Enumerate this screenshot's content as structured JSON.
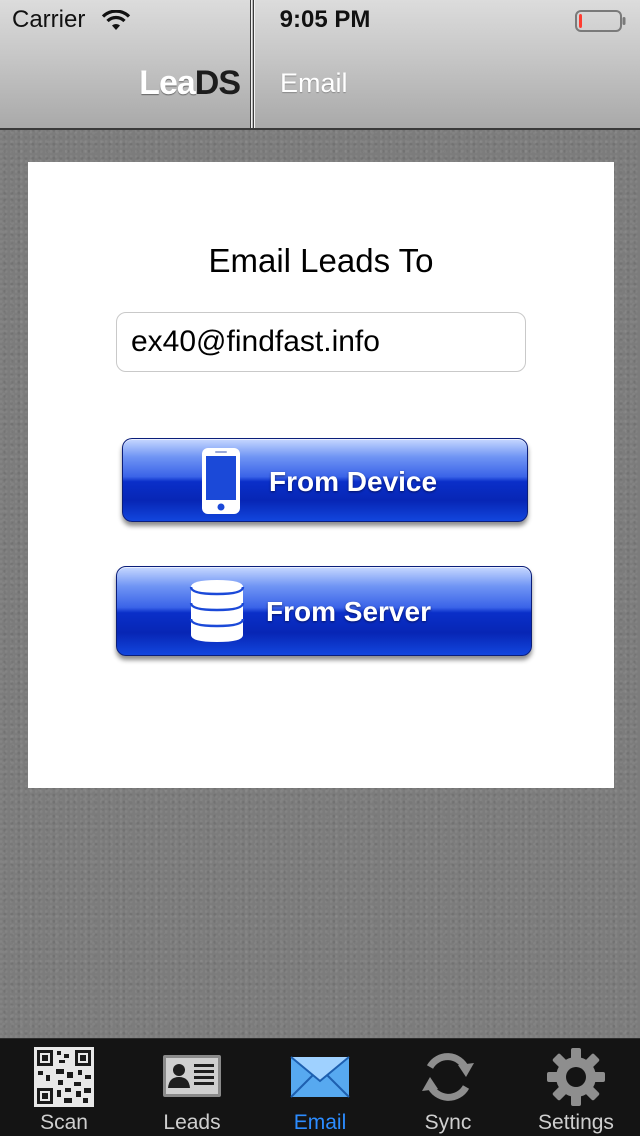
{
  "status_bar": {
    "carrier": "Carrier",
    "time": "9:05 PM",
    "battery_level": 0.08,
    "battery_color": "#ff3b30"
  },
  "header": {
    "logo_part_a": "Lea",
    "logo_part_b": "DS",
    "title": "Email"
  },
  "card": {
    "heading": "Email Leads To",
    "email_value": "ex40@findfast.info",
    "from_device_label": "From Device",
    "from_device_icon": "phone-icon",
    "from_server_label": "From Server",
    "from_server_icon": "database-icon",
    "button_color": "#0a2fc9"
  },
  "tabbar": {
    "active_color": "#2c8cff",
    "tabs": [
      {
        "label": "Scan",
        "icon": "qr-code-icon"
      },
      {
        "label": "Leads",
        "icon": "contact-card-icon"
      },
      {
        "label": "Email",
        "icon": "envelope-icon",
        "active": true
      },
      {
        "label": "Sync",
        "icon": "sync-icon"
      },
      {
        "label": "Settings",
        "icon": "gear-icon"
      }
    ]
  }
}
